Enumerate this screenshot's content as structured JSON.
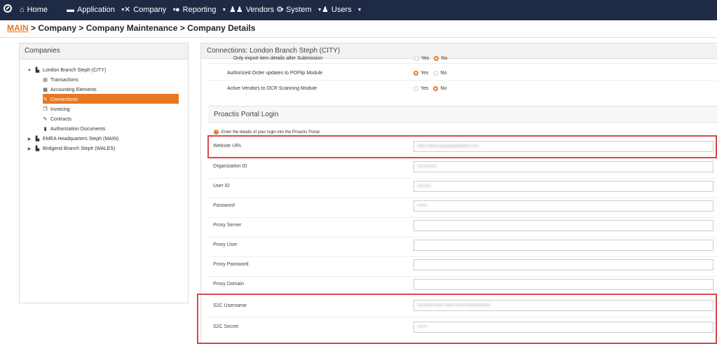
{
  "nav": {
    "items": [
      {
        "label": "Home",
        "icon": "home-icon",
        "caret": false
      },
      {
        "label": "Application",
        "icon": "application-icon",
        "caret": true
      },
      {
        "label": "Company",
        "icon": "wrench-icon",
        "caret": true
      },
      {
        "label": "Reporting",
        "icon": "pie-chart-icon",
        "caret": true
      },
      {
        "label": "Vendors",
        "icon": "users-icon",
        "caret": true
      },
      {
        "label": "System",
        "icon": "gear-icon",
        "caret": true
      },
      {
        "label": "Users",
        "icon": "user-icon",
        "caret": true
      }
    ],
    "caret_glyph": "▼"
  },
  "breadcrumb": {
    "main": "MAIN",
    "rest": " > Company > Company Maintenance > Company Details"
  },
  "left": {
    "title": "Companies",
    "tree": [
      {
        "label": "London Branch Steph (CITY)",
        "level": 0,
        "toggle": "▼",
        "icon": "building-icon",
        "glyph": "▙"
      },
      {
        "label": "Transactions",
        "level": 1,
        "toggle": "",
        "icon": "document-icon",
        "glyph": "▤"
      },
      {
        "label": "Accounting Elements",
        "level": 1,
        "toggle": "",
        "icon": "grid-icon",
        "glyph": "▦"
      },
      {
        "label": "Connections",
        "level": 1,
        "toggle": "",
        "icon": "plug-icon",
        "glyph": "✎",
        "selected": true
      },
      {
        "label": "Invoicing",
        "level": 1,
        "toggle": "",
        "icon": "copy-icon",
        "glyph": "❐"
      },
      {
        "label": "Contracts",
        "level": 1,
        "toggle": "",
        "icon": "edit-icon",
        "glyph": "✎"
      },
      {
        "label": "Authorization Documents",
        "level": 1,
        "toggle": "",
        "icon": "file-icon",
        "glyph": "▮"
      },
      {
        "label": "EMEA Headquarters Steph (MAIN)",
        "level": 0,
        "toggle": "▶",
        "icon": "building-icon",
        "glyph": "▙"
      },
      {
        "label": "Bridgend Branch Steph (WALES)",
        "level": 0,
        "toggle": "▶",
        "icon": "building-icon",
        "glyph": "▙"
      }
    ]
  },
  "right": {
    "title": "Connections: London Branch Steph (CITY)",
    "options": [
      {
        "label": "Only export item details after Submission",
        "yes": "Yes",
        "no": "No",
        "value": "No"
      },
      {
        "label": "Authorized Order updates to POFlip Module",
        "yes": "Yes",
        "no": "No",
        "value": "Yes"
      },
      {
        "label": "Active Vendors to OCR Scanning Module",
        "yes": "Yes",
        "no": "No",
        "value": "No"
      }
    ],
    "section_title": "Proactis Portal Login",
    "info_text": "Enter the details of your login into the Proactis Portal.",
    "info_glyph": "!",
    "fields": [
      {
        "label": "Website URL",
        "value": "https://www.proactisplatform.com"
      },
      {
        "label": "Organization ID",
        "value": "XXXXXXX"
      },
      {
        "label": "User ID",
        "value": "XXXXX"
      },
      {
        "label": "Password",
        "value": "•••••••"
      },
      {
        "label": "Proxy Server",
        "value": ""
      },
      {
        "label": "Proxy User",
        "value": ""
      },
      {
        "label": "Proxy Password",
        "value": ""
      },
      {
        "label": "Proxy Domain",
        "value": ""
      },
      {
        "label": "S2C Username",
        "value": "xxxxxxxx-xxxx-xxxx-xxxx-xxxxxxxxxxxx"
      },
      {
        "label": "S2C Secret",
        "value": "•••••••"
      }
    ]
  },
  "colors": {
    "accent": "#e87722",
    "nav_bg": "#1f2a44",
    "highlight": "#d9484a"
  }
}
